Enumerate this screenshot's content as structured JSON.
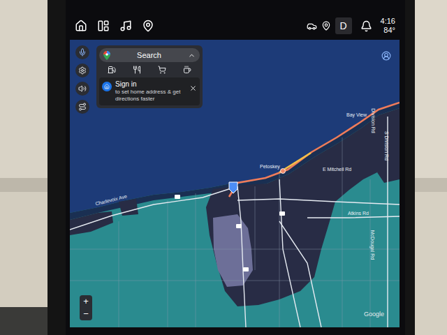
{
  "status_bar": {
    "gear": "D",
    "time": "4:16",
    "temperature": "84°"
  },
  "search": {
    "label": "Search",
    "expanded": true
  },
  "sign_in_card": {
    "title": "Sign in",
    "subtitle": "to set home address & get directions faster"
  },
  "map": {
    "labels": [
      {
        "text": "Bay View"
      },
      {
        "text": "Petoskey"
      },
      {
        "text": "E Mitchell Rd"
      },
      {
        "text": "Charlevoix Ave"
      },
      {
        "text": "Atkins Rd"
      },
      {
        "text": "McDougal Rd"
      },
      {
        "text": "S Division Rd"
      },
      {
        "text": "Division Rd"
      }
    ],
    "attribution": "Google"
  },
  "zoom": {
    "in": "+",
    "out": "−"
  }
}
